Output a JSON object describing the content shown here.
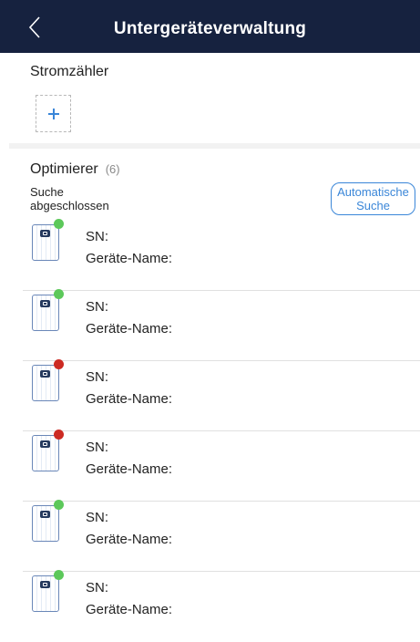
{
  "header": {
    "title": "Untergeräteverwaltung",
    "back_icon": "chevron-left-icon"
  },
  "meter": {
    "label": "Stromzähler",
    "add_icon": "plus-icon"
  },
  "optimizer": {
    "label": "Optimierer",
    "count": "(6)",
    "search_status": "Suche abgeschlossen",
    "auto_search_label": "Automatische Suche",
    "devices": [
      {
        "sn_label": "SN:",
        "name_label": "Geräte-Name:",
        "status_color": "#5cc85a"
      },
      {
        "sn_label": "SN:",
        "name_label": "Geräte-Name:",
        "status_color": "#5cc85a"
      },
      {
        "sn_label": "SN:",
        "name_label": "Geräte-Name:",
        "status_color": "#cc2a22"
      },
      {
        "sn_label": "SN:",
        "name_label": "Geräte-Name:",
        "status_color": "#cc2a22"
      },
      {
        "sn_label": "SN:",
        "name_label": "Geräte-Name:",
        "status_color": "#5cc85a"
      },
      {
        "sn_label": "SN:",
        "name_label": "Geräte-Name:",
        "status_color": "#5cc85a"
      }
    ]
  },
  "colors": {
    "header_bg": "#16223f",
    "accent": "#3a86d8",
    "online": "#5cc85a",
    "offline": "#cc2a22"
  }
}
